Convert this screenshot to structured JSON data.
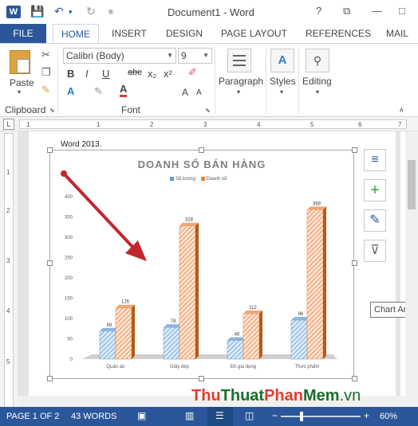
{
  "app": {
    "logo_letter": "W",
    "title": "Document1 - Word",
    "help": "?",
    "win_controls": [
      "⧉",
      "—",
      "□"
    ]
  },
  "tabs": {
    "file": "FILE",
    "home": "HOME",
    "insert": "INSERT",
    "design": "DESIGN",
    "page_layout": "PAGE LAYOUT",
    "references": "REFERENCES",
    "mailings": "MAIL"
  },
  "ribbon": {
    "paste_label": "Paste",
    "clipboard_label": "Clipboard",
    "font_name": "Calibri (Body)",
    "font_size": "9",
    "font_label": "Font",
    "paragraph_label": "Paragraph",
    "styles_label": "Styles",
    "editing_label": "Editing",
    "bold": "B",
    "italic": "I",
    "underline": "U",
    "strike": "abc",
    "subscript": "x₂",
    "superscript": "x²",
    "grow": "A",
    "shrink": "A"
  },
  "ruler": {
    "corner": "L",
    "h_numbers": [
      "1",
      "1",
      "2",
      "3",
      "4",
      "5",
      "6",
      "7"
    ],
    "v_numbers": [
      "1",
      "1",
      "2",
      "3",
      "4",
      "5"
    ]
  },
  "document": {
    "text_line": "Word 2013."
  },
  "chart_data": {
    "type": "bar",
    "title": "DOANH SỐ BÁN HÀNG",
    "categories": [
      "Quần áo",
      "Giầy dép",
      "Đồ gia dụng",
      "Thực phẩm"
    ],
    "series": [
      {
        "name": "Số lượng",
        "values": [
          69,
          78,
          46,
          96
        ],
        "color": "#5b9bd5"
      },
      {
        "name": "Doanh số",
        "values": [
          126,
          328,
          112,
          368
        ],
        "color": "#ed7d31"
      }
    ],
    "yticks": [
      "0",
      "50",
      "100",
      "150",
      "200",
      "250",
      "300",
      "350",
      "400"
    ],
    "ylim": [
      0,
      400
    ],
    "legend": "top"
  },
  "side_buttons": {
    "layout_icon": "≡",
    "add_icon": "+",
    "style_icon": "✎",
    "filter_icon": "⊽"
  },
  "tooltip": "Chart Area",
  "watermark": {
    "part1": "Thu",
    "part2": "Thuat",
    "part3": "Phan",
    "part4": "Mem",
    "part5": ".vn"
  },
  "status": {
    "page": "PAGE 1 OF 2",
    "words": "43 WORDS",
    "zoom": "60%"
  }
}
